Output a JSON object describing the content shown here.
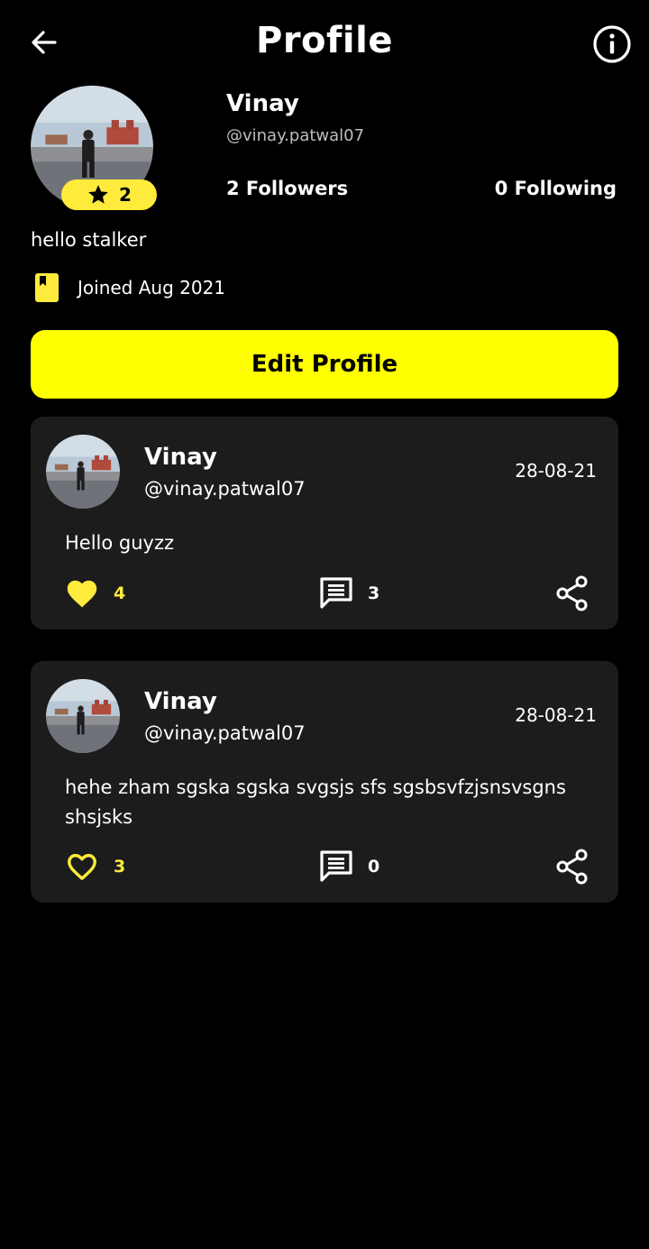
{
  "header": {
    "title": "Profile"
  },
  "icons": {
    "back": "arrow-left-icon",
    "info": "info-circle-icon",
    "star": "star-icon",
    "joined": "bookmark-icon",
    "like": "heart-icon",
    "comment": "comment-icon",
    "share": "share-icon"
  },
  "colors": {
    "accent": "#ffff00",
    "badge": "#ffeb3b",
    "card": "#1c1c1c",
    "background": "#000000"
  },
  "profile": {
    "name": "Vinay",
    "handle": "@vinay.patwal07",
    "badge_count": "2",
    "followers": "2 Followers",
    "following": "0 Following",
    "bio": "hello stalker",
    "joined": "Joined Aug 2021",
    "edit_label": "Edit Profile"
  },
  "posts": [
    {
      "name": "Vinay",
      "handle": "@vinay.patwal07",
      "date": "28-08-21",
      "text": "Hello guyzz",
      "likes": "4",
      "liked": true,
      "comments": "3"
    },
    {
      "name": "Vinay",
      "handle": "@vinay.patwal07",
      "date": "28-08-21",
      "text": "hehe zham sgska sgska svgsjs sfs sgsbsvfzjsnsvsgns shsjsks",
      "likes": "3",
      "liked": false,
      "comments": "0"
    }
  ]
}
